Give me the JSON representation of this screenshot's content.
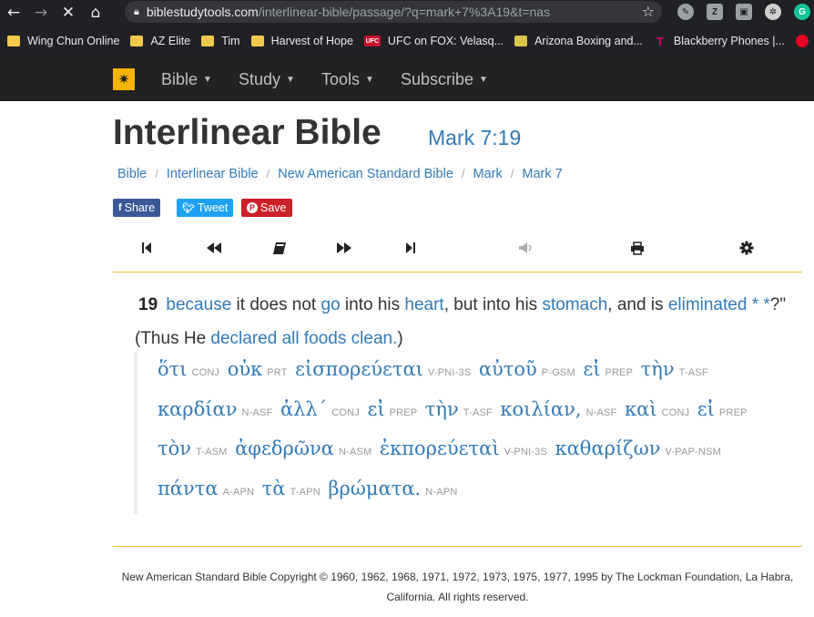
{
  "browser": {
    "url_host": "biblestudytools.com",
    "url_path": "/interlinear-bible/passage/?q=mark+7%3A19&t=nas",
    "bookmarks": [
      {
        "label": "Wing Chun Online",
        "icon": "folder-icon"
      },
      {
        "label": "AZ Elite",
        "icon": "folder-icon"
      },
      {
        "label": "Tim",
        "icon": "folder-icon"
      },
      {
        "label": "Harvest of Hope",
        "icon": "folder-icon"
      },
      {
        "label": "UFC on FOX: Velasq...",
        "icon": "ufc-icon"
      },
      {
        "label": "Arizona Boxing and...",
        "icon": "az-boxing-icon"
      },
      {
        "label": "Blackberry Phones |...",
        "icon": "tmobile-icon"
      }
    ],
    "ufc_badge": "UFC",
    "tmobile_glyph": "T"
  },
  "nav": {
    "items": [
      "Bible",
      "Study",
      "Tools",
      "Subscribe"
    ]
  },
  "page": {
    "title": "Interlinear Bible",
    "reference": "Mark 7:19",
    "breadcrumb": [
      "Bible",
      "Interlinear Bible",
      "New American Standard Bible",
      "Mark",
      "Mark 7"
    ],
    "share": {
      "facebook": "Share",
      "twitter": "Tweet",
      "pinterest": "Save"
    }
  },
  "verse": {
    "number": "19",
    "segments": [
      {
        "text": "because",
        "link": true
      },
      {
        "text": " it does not ",
        "link": false
      },
      {
        "text": "go",
        "link": true
      },
      {
        "text": " into his ",
        "link": false
      },
      {
        "text": "heart",
        "link": true
      },
      {
        "text": ", but into his ",
        "link": false
      },
      {
        "text": "stomach",
        "link": true
      },
      {
        "text": ", and is ",
        "link": false
      },
      {
        "text": "eliminated *",
        "link": true
      },
      {
        "text": " *",
        "link": true
      },
      {
        "text": "?\" (Thus He ",
        "link": false
      },
      {
        "text": "declared",
        "link": true
      },
      {
        "text": " ",
        "link": false
      },
      {
        "text": "all",
        "link": true
      },
      {
        "text": " ",
        "link": false
      },
      {
        "text": "foods",
        "link": true
      },
      {
        "text": " ",
        "link": false
      },
      {
        "text": "clean.",
        "link": true
      },
      {
        "text": ")",
        "link": false
      }
    ]
  },
  "interlinear": [
    {
      "greek": "ὅτι",
      "parse": "CONJ"
    },
    {
      "greek": "οὐκ",
      "parse": "PRT"
    },
    {
      "greek": "εἰσπορεύεται",
      "parse": "V-PNI-3S"
    },
    {
      "greek": "αὐτοῦ",
      "parse": "P-GSM"
    },
    {
      "greek": "εἰ̓",
      "parse": "PREP"
    },
    {
      "greek": "τὴν",
      "parse": "T-ASF"
    },
    {
      "greek": "καρδίαν",
      "parse": "N-ASF"
    },
    {
      "greek": "ἀλλ΄",
      "parse": "CONJ"
    },
    {
      "greek": "εἰ̓",
      "parse": "PREP"
    },
    {
      "greek": "τὴν",
      "parse": "T-ASF"
    },
    {
      "greek": "κοιλίαν,",
      "parse": "N-ASF"
    },
    {
      "greek": "καὶ",
      "parse": "CONJ"
    },
    {
      "greek": "εἰ̓",
      "parse": "PREP"
    },
    {
      "greek": "τὸν",
      "parse": "T-ASM"
    },
    {
      "greek": "ἀφεδρῶνα",
      "parse": "N-ASM"
    },
    {
      "greek": "ἐκπορεύεταὶ",
      "parse": "V-PNI-3S"
    },
    {
      "greek": "καθαρίζων",
      "parse": "V-PAP-NSM"
    },
    {
      "greek": "πάντα",
      "parse": "A-APN"
    },
    {
      "greek": "τὰ",
      "parse": "T-APN"
    },
    {
      "greek": "βρώματα.",
      "parse": "N-APN"
    }
  ],
  "footer": {
    "line1": "New American Standard Bible Copyright © 1960, 1962, 1968, 1971, 1972, 1973, 1975, 1977, 1995 by The Lockman Foundation, La Habra,",
    "line2": "California.  All rights reserved."
  },
  "colors": {
    "link": "#337ab7",
    "accent": "#f0c040",
    "nav_bg": "#222222"
  }
}
